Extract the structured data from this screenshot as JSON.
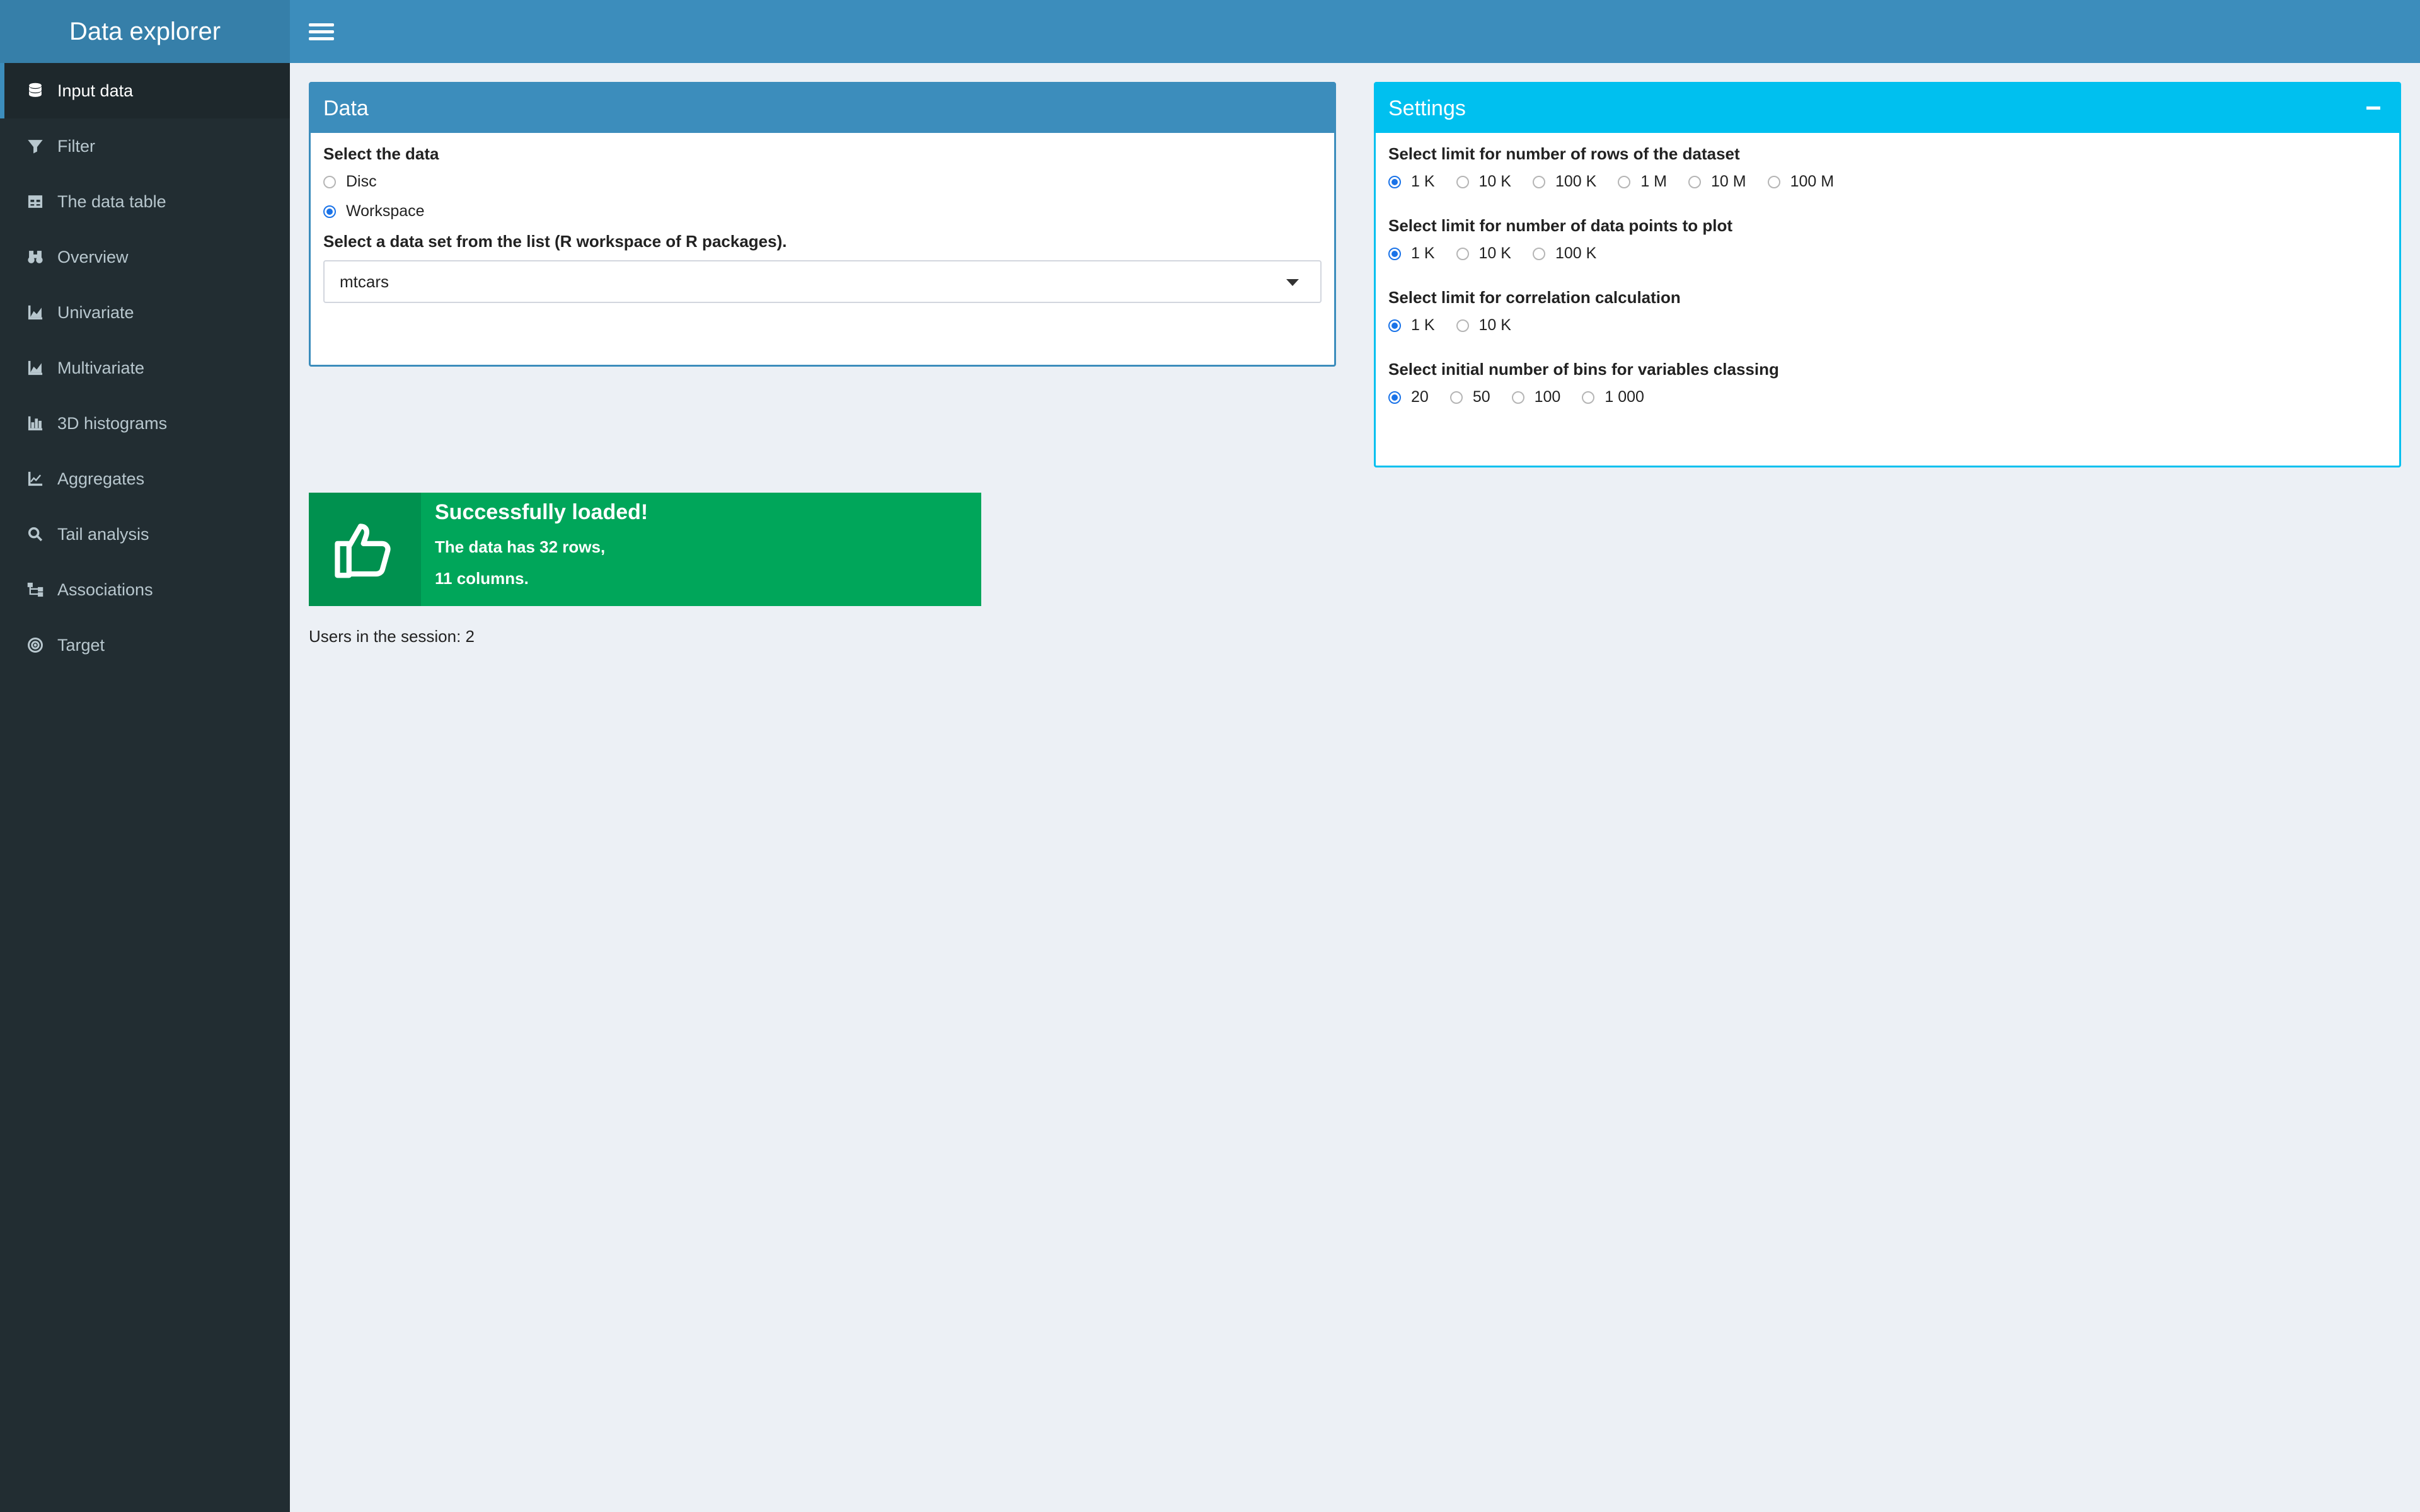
{
  "app": {
    "title": "Data explorer"
  },
  "sidebar": {
    "items": [
      {
        "label": "Input data",
        "icon": "database-icon"
      },
      {
        "label": "Filter",
        "icon": "filter-icon"
      },
      {
        "label": "The data table",
        "icon": "table-icon"
      },
      {
        "label": "Overview",
        "icon": "binoculars-icon"
      },
      {
        "label": "Univariate",
        "icon": "area-chart-icon"
      },
      {
        "label": "Multivariate",
        "icon": "area-chart-icon"
      },
      {
        "label": "3D histograms",
        "icon": "bar-chart-icon"
      },
      {
        "label": "Aggregates",
        "icon": "line-chart-icon"
      },
      {
        "label": "Tail analysis",
        "icon": "search-icon"
      },
      {
        "label": "Associations",
        "icon": "sitemap-icon"
      },
      {
        "label": "Target",
        "icon": "bullseye-icon"
      }
    ],
    "active": "Input data"
  },
  "data_box": {
    "title": "Data",
    "select_label": "Select the data",
    "source_options": [
      "Disc",
      "Workspace"
    ],
    "source_selected": "Workspace",
    "dataset_label": "Select a data set from the list (R workspace of R packages).",
    "dataset_value": "mtcars"
  },
  "settings_box": {
    "title": "Settings",
    "groups": [
      {
        "label": "Select limit for number of rows of the dataset",
        "options": [
          "1 K",
          "10 K",
          "100 K",
          "1 M",
          "10 M",
          "100 M"
        ],
        "selected": "1 K"
      },
      {
        "label": "Select limit for number of data points to plot",
        "options": [
          "1 K",
          "10 K",
          "100 K"
        ],
        "selected": "1 K"
      },
      {
        "label": "Select limit for correlation calculation",
        "options": [
          "1 K",
          "10 K"
        ],
        "selected": "1 K"
      },
      {
        "label": "Select initial number of bins for variables classing",
        "options": [
          "20",
          "50",
          "100",
          "1 000"
        ],
        "selected": "20"
      }
    ]
  },
  "info": {
    "title": "Successfully loaded!",
    "line1": "The data has 32 rows,",
    "line2": "11 columns."
  },
  "session": {
    "users_text": "Users in the session: 2"
  },
  "colors": {
    "header": "#3c8dbc",
    "brand": "#367fa9",
    "sidebar": "#222d32",
    "settings_header": "#00c0ef",
    "success": "#00a65a"
  }
}
